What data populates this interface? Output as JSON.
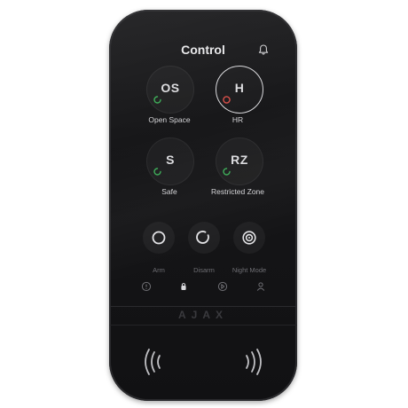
{
  "screen": {
    "title": "Control",
    "notification_icon": "bell-icon"
  },
  "zones": [
    {
      "code": "OS",
      "label": "Open Space",
      "status_color": "#3fae5a",
      "selected": false
    },
    {
      "code": "H",
      "label": "HR",
      "status_color": "#d9504a",
      "selected": true
    },
    {
      "code": "S",
      "label": "Safe",
      "status_color": "#3fae5a",
      "selected": false
    },
    {
      "code": "RZ",
      "label": "Restricted Zone",
      "status_color": "#3fae5a",
      "selected": false
    }
  ],
  "actions": [
    {
      "label": "Arm",
      "icon": "arm-circle-icon"
    },
    {
      "label": "Disarm",
      "icon": "disarm-open-circle-icon"
    },
    {
      "label": "Night Mode",
      "icon": "night-mode-icon"
    }
  ],
  "tabs": [
    {
      "icon": "alarm-exclamation-icon",
      "active": false
    },
    {
      "icon": "lock-icon",
      "active": true
    },
    {
      "icon": "scenario-icon",
      "active": false
    },
    {
      "icon": "user-icon",
      "active": false
    }
  ],
  "brand": "AJAX",
  "reader_icons": [
    "nfc-left-icon",
    "nfc-right-icon"
  ],
  "colors": {
    "device_body": "#151517",
    "armed_green": "#3fae5a",
    "alert_red": "#d9504a",
    "text_primary": "#e8e8ea",
    "text_muted": "#6e6e73"
  }
}
